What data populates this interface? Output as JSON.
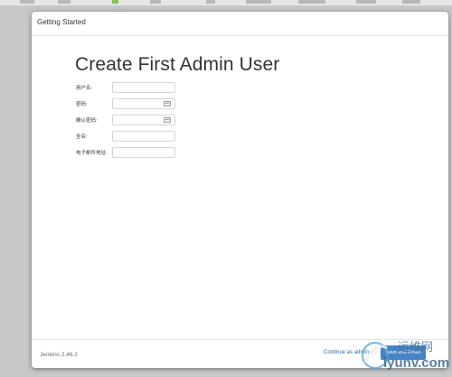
{
  "dialog": {
    "title": "Getting Started"
  },
  "form": {
    "heading": "Create First Admin User",
    "fields": [
      {
        "label": "用户名:",
        "value": "",
        "type": "text"
      },
      {
        "label": "密码:",
        "value": "",
        "type": "password",
        "icon": "key-icon"
      },
      {
        "label": "确认密码:",
        "value": "",
        "type": "password",
        "icon": "key-icon"
      },
      {
        "label": "全名:",
        "value": "",
        "type": "text"
      },
      {
        "label": "电子邮件地址:",
        "value": "",
        "type": "text"
      }
    ]
  },
  "footer": {
    "version": "Jenkins 2.46.2",
    "continue_label": "Continue as admin",
    "save_label": "Save and Finish"
  },
  "watermark": {
    "cn": "运维网",
    "en": "iyunv.com"
  },
  "colors": {
    "primary": "#4585c5",
    "link": "#2a6aa6",
    "backdrop": "#c8c8c8"
  }
}
